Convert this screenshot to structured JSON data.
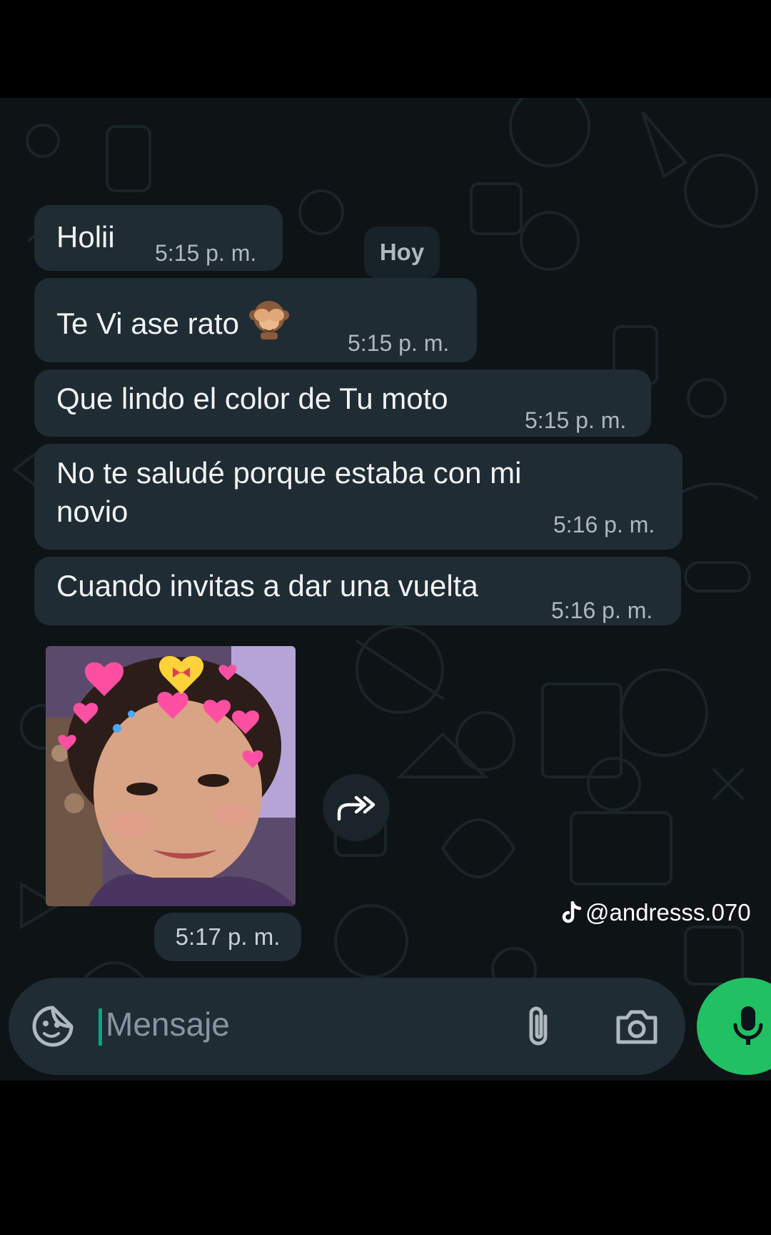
{
  "chat": {
    "date_separator": "Hoy",
    "messages": [
      {
        "text": "Holii",
        "time": "5:15 p. m."
      },
      {
        "text": "Te Vi ase rato",
        "emoji": "see-no-evil-monkey",
        "time": "5:15 p. m."
      },
      {
        "text": "Que lindo el color de Tu moto",
        "time": "5:15 p. m."
      },
      {
        "text_line1": "No te saludé porque estaba con mi",
        "text_line2": "novio",
        "time": "5:16 p. m."
      },
      {
        "text": "Cuando invitas a dar una vuelta",
        "time": "5:16 p. m."
      }
    ],
    "image_message": {
      "time": "5:17 p. m."
    },
    "watermark": "@andresss.070"
  },
  "composer": {
    "placeholder": "Mensaje",
    "icons": [
      "sticker-icon",
      "paperclip-icon",
      "camera-icon",
      "microphone-icon"
    ]
  },
  "colors": {
    "background": "#0e1316",
    "bubble": "#1f2c34",
    "mic_button": "#21c063",
    "caret": "#00a884"
  }
}
